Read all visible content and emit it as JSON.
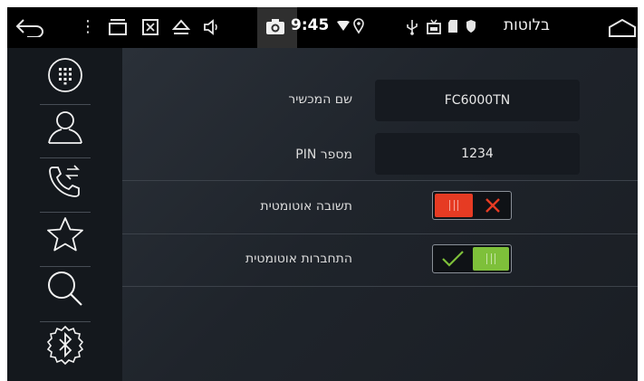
{
  "status_bar": {
    "time": "9:45",
    "title": "בלוטות",
    "menu_glyph": "⋮",
    "icons": [
      "back-icon",
      "menu-icon",
      "recent-apps-icon",
      "screenshot-icon",
      "eject-icon",
      "volume-icon",
      "camera-icon",
      "wifi-icon",
      "location-icon",
      "usb-icon",
      "cast-icon",
      "sd-card-icon",
      "shield-icon",
      "home-icon"
    ]
  },
  "sidebar": {
    "items": [
      {
        "name": "dialpad",
        "icon": "dialpad-icon",
        "active": false
      },
      {
        "name": "contacts",
        "icon": "person-icon",
        "active": false
      },
      {
        "name": "call-log",
        "icon": "call-transfer-icon",
        "active": false
      },
      {
        "name": "favorites",
        "icon": "star-icon",
        "active": false
      },
      {
        "name": "search",
        "icon": "search-icon",
        "active": false
      },
      {
        "name": "bluetooth-settings",
        "icon": "bluetooth-gear-icon",
        "active": true
      }
    ]
  },
  "settings": {
    "device_name_label": "שם המכשיר",
    "device_name_value": "FC6000TN",
    "pin_label": "מספר PIN",
    "pin_value": "1234",
    "auto_answer_label": "תשובה אוטומטית",
    "auto_answer_on": false,
    "auto_connect_label": "התחברות אוטומטית",
    "auto_connect_on": true
  },
  "colors": {
    "toggle_off": "#e63b23",
    "toggle_on": "#7ec03a",
    "background": "#1c2128"
  }
}
